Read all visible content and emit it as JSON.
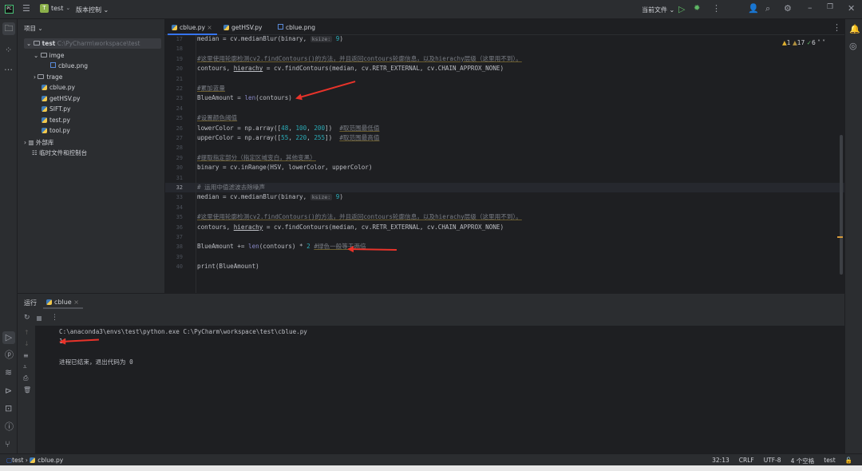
{
  "titlebar": {
    "project_badge": "T",
    "project_name": "test",
    "vcs": "版本控制",
    "run_config": "当前文件"
  },
  "project_panel": {
    "title": "项目",
    "root": "test",
    "root_path": "C:\\PyCharm\\workspace\\test",
    "items": [
      {
        "label": "imge",
        "type": "folder",
        "level": 1,
        "expanded": true
      },
      {
        "label": "cblue.png",
        "type": "image",
        "level": 2
      },
      {
        "label": "trage",
        "type": "folder",
        "level": 1,
        "expanded": false
      },
      {
        "label": "cblue.py",
        "type": "py",
        "level": 1
      },
      {
        "label": "getHSV.py",
        "type": "py",
        "level": 1
      },
      {
        "label": "SIFT.py",
        "type": "py",
        "level": 1
      },
      {
        "label": "test.py",
        "type": "py",
        "level": 1
      },
      {
        "label": "tool.py",
        "type": "py",
        "level": 1
      }
    ],
    "external": "外部库",
    "scratch": "临时文件和控制台"
  },
  "tabs": [
    {
      "label": "cblue.py",
      "active": true
    },
    {
      "label": "getHSV.py"
    },
    {
      "label": "cblue.png"
    }
  ],
  "inspections": {
    "warnings": "1",
    "weak": "17",
    "ok": "6"
  },
  "code": {
    "l17": "17",
    "l18": "18",
    "l19": "19",
    "l20": "20",
    "l21": "21",
    "l22": "22",
    "l23": "23",
    "l24": "24",
    "l25": "25",
    "l26": "26",
    "l27": "27",
    "l28": "28",
    "l29": "29",
    "l30": "30",
    "l31": "31",
    "l32": "32",
    "l33": "33",
    "l34": "34",
    "l35": "35",
    "l36": "36",
    "l37": "37",
    "l38": "38",
    "l39": "39",
    "l40": "40",
    "median_pre": "median = cv.medianBlur(binary, ",
    "hint": "ksize:",
    "ksize": "9",
    "c19": "#这里使用轮廓检测cv2.findContours()的方法，并且返回contours轮廓信息，以及hierachy层级（这里用不到）。",
    "contours_a": "contours, ",
    "hierachy": "hierachy",
    "contours_b": " = cv.findContours(median, cv.RETR_EXTERNAL, cv.CHAIN_APPROX_NONE)",
    "c22": "#累加蓝量",
    "blue_a": "BlueAmount = ",
    "len": "len",
    "blue_b": "(contours)",
    "c25": "#设置颜色阈值",
    "lower_a": "lowerColor = np.array([",
    "lower_n1": "48",
    "lower_n2": "100",
    "lower_n3": "200",
    "lower_c": "#取范围最低值",
    "upper_a": "upperColor = np.array([",
    "upper_n1": "55",
    "upper_n2": "220",
    "upper_n3": "255",
    "upper_c": "#取范围最高值",
    "c29": "#提取指定部分（指定区域变白，其他变黑）",
    "binary": "binary = cv.inRange(HSV, lowerColor, upperColor)",
    "c32": "# 运用中值滤波去除噪声",
    "blue2_a": "BlueAmount += ",
    "blue2_b": "(contours) * ",
    "two": "2",
    "c38": "#绿色一般等于两倍",
    "print": "print(BlueAmount)"
  },
  "run": {
    "label": "运行",
    "tab": "cblue",
    "cmd": "C:\\anaconda3\\envs\\test\\python.exe C:\\PyCharm\\workspace\\test\\cblue.py",
    "output": "14",
    "exit": "进程已结束，退出代码为 0"
  },
  "status": {
    "crumb_root": "test",
    "crumb_file": "cblue.py",
    "position": "32:13",
    "line_sep": "CRLF",
    "encoding": "UTF-8",
    "indent": "4 个空格",
    "interpreter": "test"
  },
  "colors": {
    "accent": "#3574f0",
    "arrow": "#e8332a",
    "run_green": "#5fb865"
  }
}
